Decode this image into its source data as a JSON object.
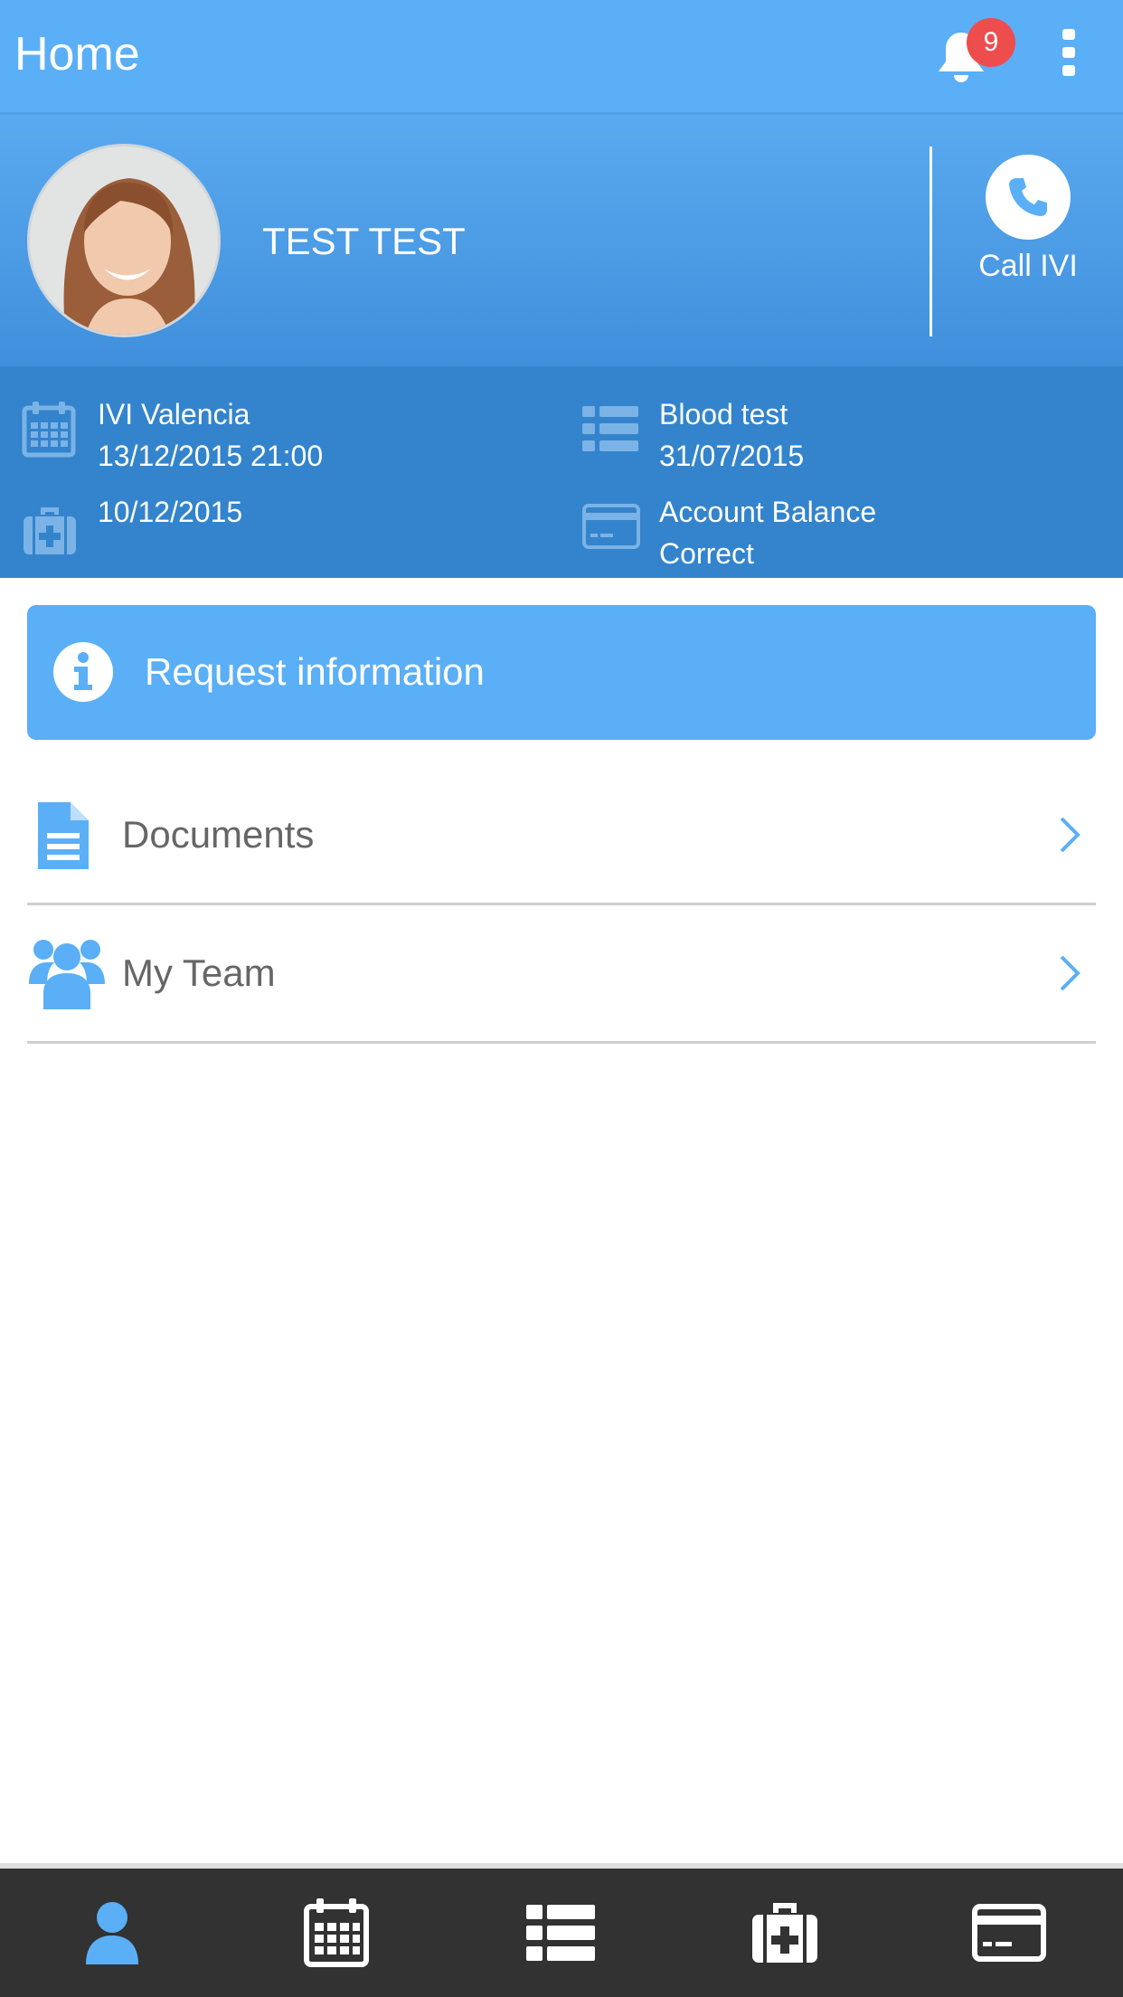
{
  "app_bar": {
    "title": "Home",
    "notification_count": "9"
  },
  "profile": {
    "name": "TEST TEST",
    "call_label": "Call IVI"
  },
  "summary": {
    "appointment": {
      "line1": "IVI Valencia",
      "line2": "13/12/2015 21:00"
    },
    "test": {
      "line1": "Blood test",
      "line2": "31/07/2015"
    },
    "treatment": {
      "line1": "10/12/2015"
    },
    "account": {
      "line1": "Account Balance",
      "line2": "Correct"
    }
  },
  "request_button": {
    "label": "Request information"
  },
  "menu": {
    "items": [
      {
        "label": "Documents",
        "icon": "document-icon"
      },
      {
        "label": "My Team",
        "icon": "team-icon"
      }
    ]
  },
  "tabbar": {
    "tabs": [
      {
        "icon": "user-icon",
        "active": true
      },
      {
        "icon": "calendar-icon",
        "active": false
      },
      {
        "icon": "list-icon",
        "active": false
      },
      {
        "icon": "medical-kit-icon",
        "active": false
      },
      {
        "icon": "credit-card-icon",
        "active": false
      }
    ]
  },
  "colors": {
    "primary": "#5aaff6",
    "header_dark": "#3384cc",
    "badge": "#ee4d4d",
    "tabbar": "#323232",
    "tab_active": "#5aaff6",
    "tab_inactive": "#ffffff"
  }
}
